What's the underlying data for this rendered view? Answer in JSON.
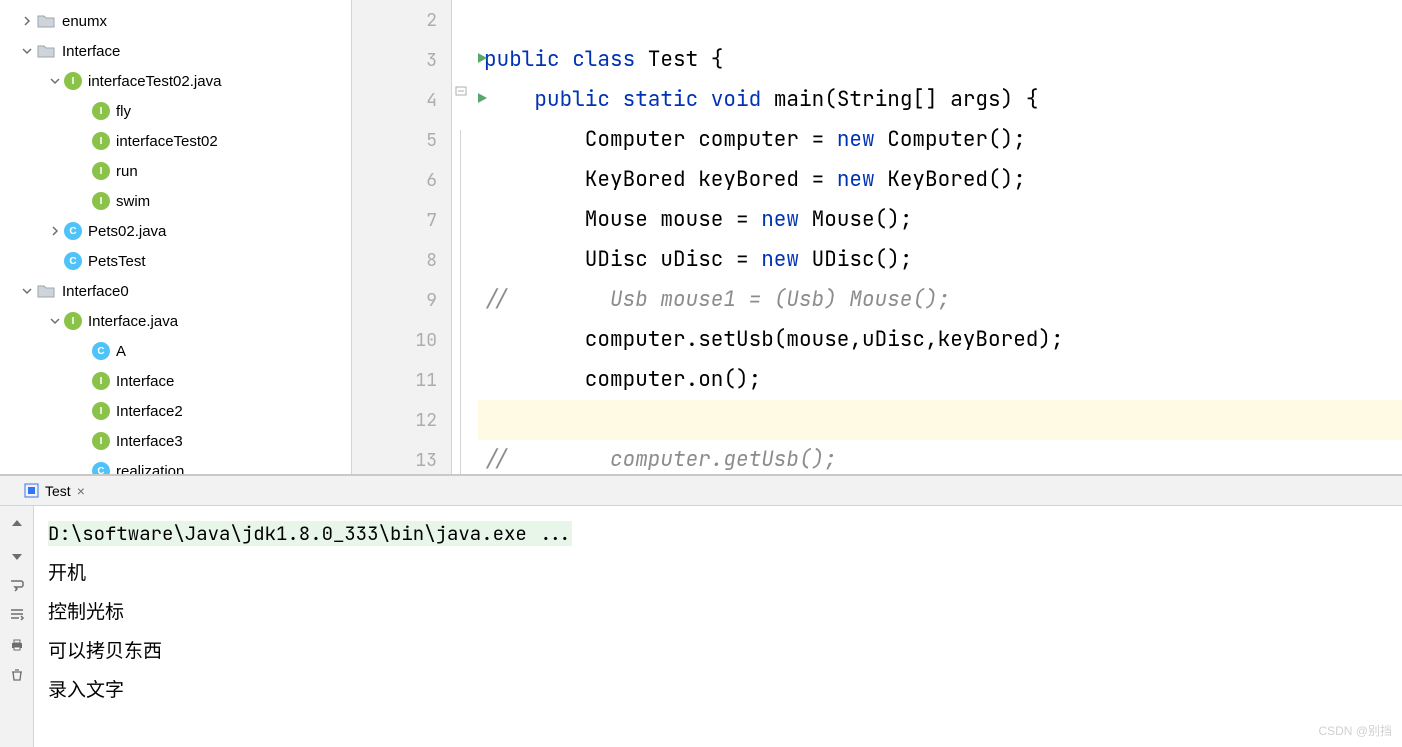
{
  "tree": [
    {
      "indent": 1,
      "chevron": "right",
      "icon": "folder",
      "label": "enumx"
    },
    {
      "indent": 1,
      "chevron": "down",
      "icon": "folder",
      "label": "Interface"
    },
    {
      "indent": 2,
      "chevron": "down",
      "icon": "i",
      "label": "interfaceTest02.java"
    },
    {
      "indent": 3,
      "chevron": "none",
      "icon": "i",
      "label": "fly"
    },
    {
      "indent": 3,
      "chevron": "none",
      "icon": "i",
      "label": "interfaceTest02"
    },
    {
      "indent": 3,
      "chevron": "none",
      "icon": "i",
      "label": "run"
    },
    {
      "indent": 3,
      "chevron": "none",
      "icon": "i",
      "label": "swim"
    },
    {
      "indent": 2,
      "chevron": "right",
      "icon": "c",
      "label": "Pets02.java"
    },
    {
      "indent": 2,
      "chevron": "none",
      "icon": "c",
      "label": "PetsTest"
    },
    {
      "indent": 1,
      "chevron": "down",
      "icon": "folder",
      "label": "Interface0"
    },
    {
      "indent": 2,
      "chevron": "down",
      "icon": "i",
      "label": "Interface.java"
    },
    {
      "indent": 3,
      "chevron": "none",
      "icon": "c",
      "label": "A"
    },
    {
      "indent": 3,
      "chevron": "none",
      "icon": "i",
      "label": "Interface"
    },
    {
      "indent": 3,
      "chevron": "none",
      "icon": "i",
      "label": "Interface2"
    },
    {
      "indent": 3,
      "chevron": "none",
      "icon": "i",
      "label": "Interface3"
    },
    {
      "indent": 3,
      "chevron": "none",
      "icon": "c",
      "label": "realization"
    }
  ],
  "gutter": {
    "numbers": [
      2,
      3,
      4,
      5,
      6,
      7,
      8,
      9,
      10,
      11,
      12,
      13
    ],
    "runnable": [
      3,
      4
    ]
  },
  "code": [
    {
      "raw": ""
    },
    {
      "raw": "<span class='kw'>public class</span> Test {"
    },
    {
      "raw": "    <span class='kw'>public static void</span> main(String[] args) {"
    },
    {
      "raw": "        Computer computer = <span class='kw'>new</span> Computer();"
    },
    {
      "raw": "        KeyBored keyBored = <span class='kw'>new</span> KeyBored();"
    },
    {
      "raw": "        Mouse mouse = <span class='kw'>new</span> Mouse();"
    },
    {
      "raw": "        UDisc uDisc = <span class='kw'>new</span> UDisc();"
    },
    {
      "raw": "<span class='cmt'>//        Usb mouse1 = (Usb) Mouse();</span>"
    },
    {
      "raw": "        computer.setUsb(mouse,uDisc,keyBored);"
    },
    {
      "raw": "        computer.on();"
    },
    {
      "raw": "",
      "hl": true
    },
    {
      "raw": "<span class='cmt'>//        computer.getUsb();</span>"
    }
  ],
  "console": {
    "tab_label": "Test",
    "cmd": "D:\\software\\Java\\jdk1.8.0_333\\bin\\java.exe ...",
    "lines": [
      "开机",
      "控制光标",
      "可以拷贝东西",
      "录入文字"
    ]
  },
  "watermark": "CSDN @别挡"
}
